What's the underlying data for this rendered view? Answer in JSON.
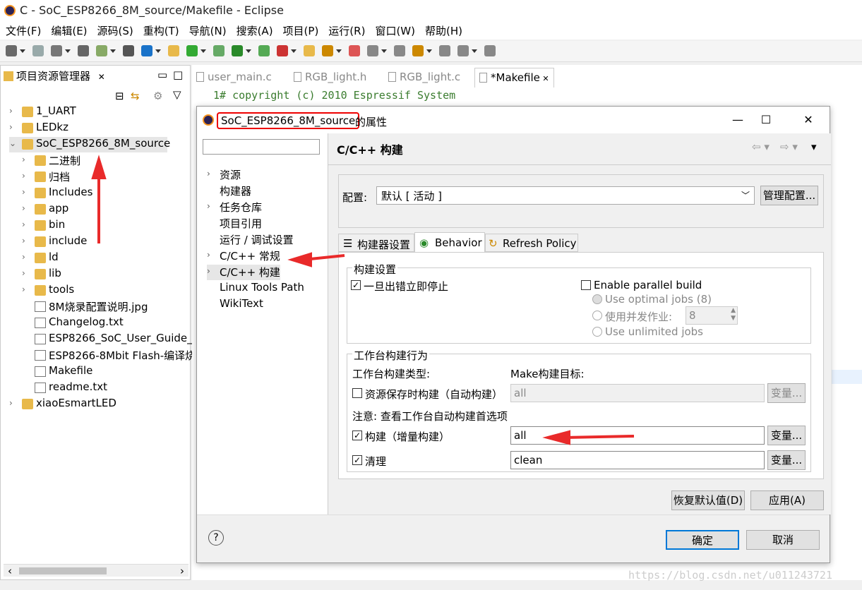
{
  "window": {
    "title": "C - SoC_ESP8266_8M_source/Makefile - Eclipse"
  },
  "menu": [
    "文件(F)",
    "编辑(E)",
    "源码(S)",
    "重构(T)",
    "导航(N)",
    "搜索(A)",
    "项目(P)",
    "运行(R)",
    "窗口(W)",
    "帮助(H)"
  ],
  "explorer": {
    "title": "项目资源管理器",
    "tree": [
      {
        "label": "1_UART",
        "level": 0,
        "icon": "project-icon"
      },
      {
        "label": "LEDkz",
        "level": 0,
        "icon": "project-icon"
      },
      {
        "label": "SoC_ESP8266_8M_source",
        "level": 0,
        "icon": "project-icon"
      },
      {
        "label": "二进制",
        "level": 1,
        "icon": "binaries-icon"
      },
      {
        "label": "归档",
        "level": 1,
        "icon": "archives-icon"
      },
      {
        "label": "Includes",
        "level": 1,
        "icon": "includes-icon"
      },
      {
        "label": "app",
        "level": 1,
        "icon": "folder-icon"
      },
      {
        "label": "bin",
        "level": 1,
        "icon": "folder-icon"
      },
      {
        "label": "include",
        "level": 1,
        "icon": "folder-icon"
      },
      {
        "label": "ld",
        "level": 1,
        "icon": "folder-icon"
      },
      {
        "label": "lib",
        "level": 1,
        "icon": "folder-icon"
      },
      {
        "label": "tools",
        "level": 1,
        "icon": "folder-icon"
      },
      {
        "label": "8M烧录配置说明.jpg",
        "level": 1,
        "icon": "file-icon"
      },
      {
        "label": "Changelog.txt",
        "level": 1,
        "icon": "file-icon"
      },
      {
        "label": "ESP8266_SoC_User_Guide_",
        "level": 1,
        "icon": "file-icon"
      },
      {
        "label": "ESP8266-8Mbit Flash-编译烧",
        "level": 1,
        "icon": "file-icon"
      },
      {
        "label": "Makefile",
        "level": 1,
        "icon": "file-icon"
      },
      {
        "label": "readme.txt",
        "level": 1,
        "icon": "file-icon"
      },
      {
        "label": "xiaoEsmartLED",
        "level": 0,
        "icon": "project-icon"
      }
    ]
  },
  "editor": {
    "tabs": [
      "user_main.c",
      "RGB_light.h",
      "RGB_light.c",
      "*Makefile"
    ],
    "code_line": "1#  copyright (c) 2010 Espressif System"
  },
  "watermark": "https://blog.csdn.net/u011243721",
  "dialog": {
    "title_project": "SoC_ESP8266_8M_source",
    "title_suffix": "的属性",
    "nav": [
      "资源",
      "构建器",
      "任务仓库",
      "项目引用",
      "运行 / 调试设置",
      "C/C++ 常规",
      "C/C++ 构建",
      "Linux Tools Path",
      "WikiText"
    ],
    "section_title": "C/C++ 构建",
    "config_label": "配置:",
    "config_value": "默认 [ 活动 ]",
    "manage_btn": "管理配置...",
    "tabs": [
      "构建器设置",
      "Behavior",
      "Refresh Policy"
    ],
    "build_settings": "构建设置",
    "stop_on_error": "一旦出错立即停止",
    "parallel": "Enable parallel build",
    "optimal_jobs": "Use optimal jobs (8)",
    "parallel_jobs": "使用并发作业:",
    "jobs_value": "8",
    "unlimited": "Use unlimited jobs",
    "workbench_group": "工作台构建行为",
    "wb_type": "工作台构建类型:",
    "make_target": "Make构建目标:",
    "auto_build": "资源保存时构建（自动构建）",
    "auto_value": "all",
    "var_btn": "变量...",
    "note": "注意: 查看工作台自动构建首选项",
    "incremental": "构建（增量构建）",
    "incremental_value": "all",
    "clean": "清理",
    "clean_value": "clean",
    "restore_btn": "恢复默认值(D)",
    "apply_btn": "应用(A)",
    "ok_btn": "确定",
    "cancel_btn": "取消"
  }
}
